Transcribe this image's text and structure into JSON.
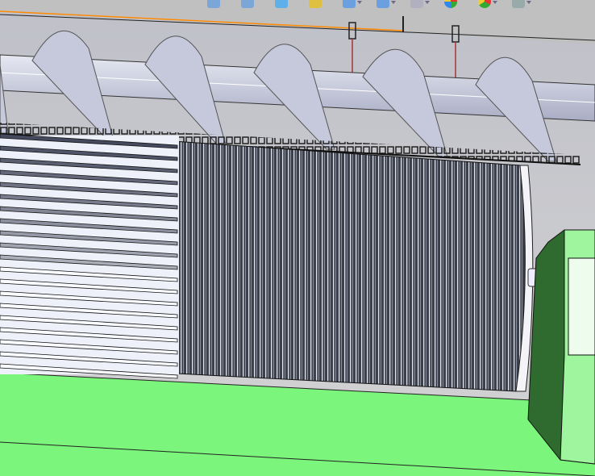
{
  "toolbar": {
    "icons": [
      {
        "name": "zoom-to-fit-icon"
      },
      {
        "name": "zoom-to-area-icon"
      },
      {
        "name": "previous-view-icon"
      },
      {
        "name": "section-view-icon"
      },
      {
        "name": "view-orientation-icon",
        "has_dropdown": true
      },
      {
        "name": "display-style-icon",
        "has_dropdown": true
      },
      {
        "name": "hide-show-items-icon",
        "has_dropdown": true
      },
      {
        "name": "edit-appearance-icon"
      },
      {
        "name": "apply-scene-icon",
        "has_dropdown": true
      },
      {
        "name": "view-settings-icon",
        "has_dropdown": true
      }
    ]
  },
  "colors": {
    "background": "#c9c9cb",
    "base_green": "#7cf57c",
    "motor_green": "#9ef59e",
    "motor_dark": "#2f6a2f",
    "drum": "#3e4350",
    "auger": "#c8cbe0"
  }
}
